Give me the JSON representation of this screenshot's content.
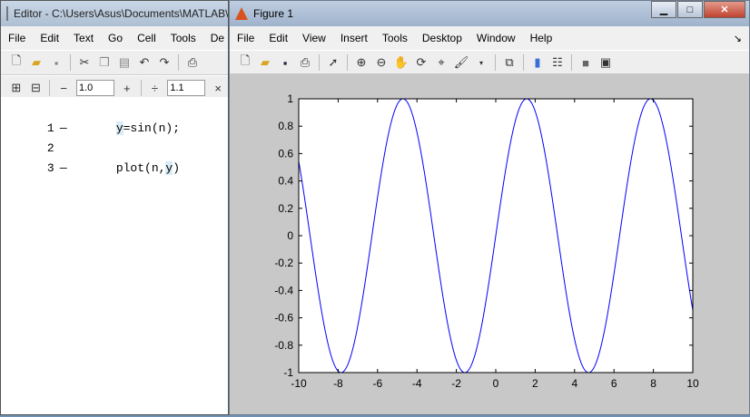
{
  "editor": {
    "title": "Editor - C:\\Users\\Asus\\Documents\\MATLAB\\",
    "menu": [
      "File",
      "Edit",
      "Text",
      "Go",
      "Cell",
      "Tools",
      "De"
    ],
    "toolbar": {
      "decrement": "−",
      "value1": "1.0",
      "increment": "+",
      "divide": "÷",
      "value2": "1.1",
      "close": "×"
    },
    "lines": [
      {
        "num": "1",
        "marker": "—",
        "pre": "",
        "hl": "y",
        "post": "=sin(n);"
      },
      {
        "num": "2",
        "marker": "",
        "pre": "",
        "hl": "",
        "post": ""
      },
      {
        "num": "3",
        "marker": "—",
        "pre": "plot(n,",
        "hl": "y",
        "post": ")"
      }
    ]
  },
  "figure": {
    "title": "Figure 1",
    "menu": [
      "File",
      "Edit",
      "View",
      "Insert",
      "Tools",
      "Desktop",
      "Window",
      "Help"
    ],
    "dock_arrow": "↘"
  },
  "chart_data": {
    "type": "line",
    "function": "sin",
    "x_range": [
      -10,
      10
    ],
    "xlim": [
      -10,
      10
    ],
    "ylim": [
      -1,
      1
    ],
    "xticks": [
      "-10",
      "-8",
      "-6",
      "-4",
      "-2",
      "0",
      "2",
      "4",
      "6",
      "8",
      "10"
    ],
    "yticks": [
      "-1",
      "-0.8",
      "-0.6",
      "-0.4",
      "-0.2",
      "0",
      "0.2",
      "0.4",
      "0.6",
      "0.8",
      "1"
    ],
    "line_color": "#0000ff",
    "grid": false
  }
}
